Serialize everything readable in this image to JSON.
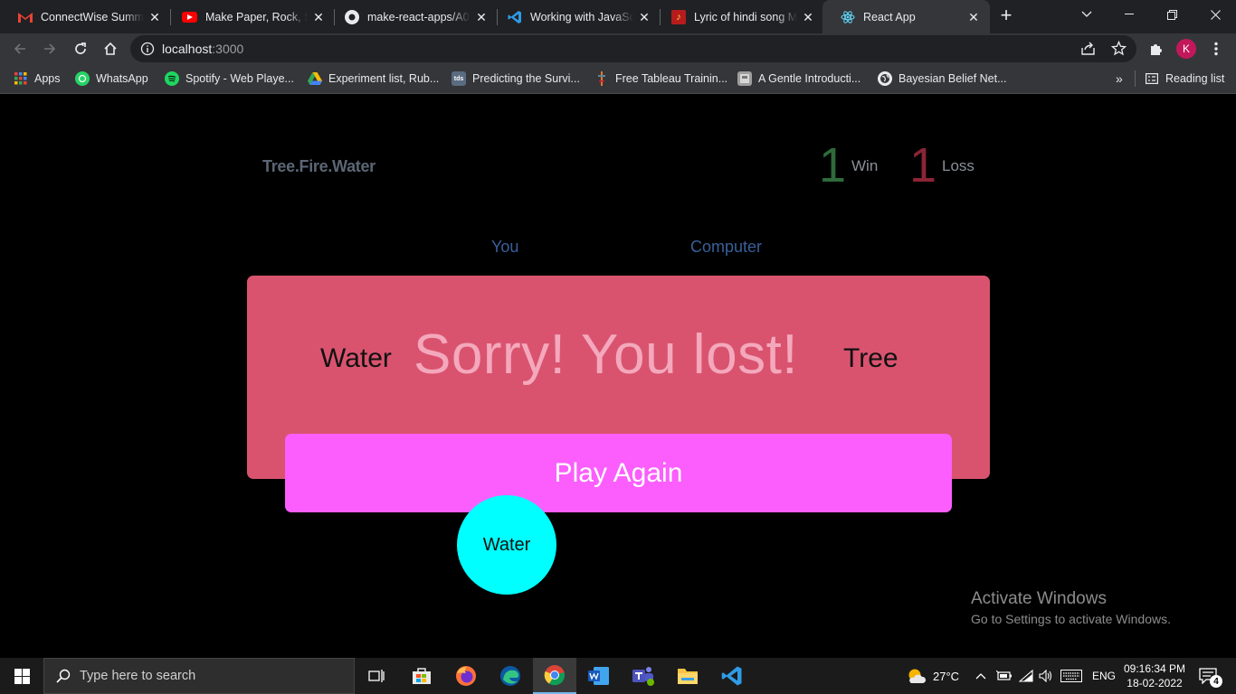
{
  "browser": {
    "tabs": [
      {
        "title": "ConnectWise Summer",
        "icon": "gmail-icon"
      },
      {
        "title": "Make Paper, Rock, Sc",
        "icon": "youtube-icon"
      },
      {
        "title": "make-react-apps/A0",
        "icon": "github-icon"
      },
      {
        "title": "Working with JavaSc",
        "icon": "vscode-icon"
      },
      {
        "title": "Lyric of hindi song M",
        "icon": "lyrics-site-icon"
      },
      {
        "title": "React App",
        "icon": "react-icon",
        "active": true
      }
    ],
    "url": {
      "host": "localhost",
      "path": ":3000"
    },
    "bookmarks": [
      {
        "label": "Apps",
        "icon": "apps-grid-icon"
      },
      {
        "label": "WhatsApp",
        "icon": "whatsapp-icon"
      },
      {
        "label": "Spotify - Web Playe...",
        "icon": "spotify-icon"
      },
      {
        "label": "Experiment list, Rub...",
        "icon": "google-drive-icon"
      },
      {
        "label": "Predicting the Survi...",
        "icon": "tds-icon"
      },
      {
        "label": "Free Tableau Trainin...",
        "icon": "tableau-icon"
      },
      {
        "label": "A Gentle Introducti...",
        "icon": "page-thumb-icon"
      },
      {
        "label": "Bayesian Belief Net...",
        "icon": "globe-icon"
      }
    ],
    "more_bookmarks": "»",
    "reading_list": "Reading list",
    "profile_initial": "K"
  },
  "game": {
    "brand": "Tree.Fire.Water",
    "wins": {
      "count": "1",
      "label": "Win",
      "color": "#2e6b3a"
    },
    "losses": {
      "count": "1",
      "label": "Loss",
      "color": "#8a2436"
    },
    "you_label": "You",
    "computer_label": "Computer",
    "user_choice": "Water",
    "computer_choice": "Tree",
    "result": "Sorry! You lost!",
    "play_again": "Play Again",
    "selected_option": "Water",
    "colors": {
      "card": "#d9536f",
      "button": "#fb5efc",
      "selected": "#00ffff"
    }
  },
  "watermark": {
    "title": "Activate Windows",
    "subtitle": "Go to Settings to activate Windows."
  },
  "taskbar": {
    "search_placeholder": "Type here to search",
    "temperature": "27°C",
    "language": "ENG",
    "time": "09:16:34 PM",
    "date": "18-02-2022",
    "notification_count": "4"
  }
}
